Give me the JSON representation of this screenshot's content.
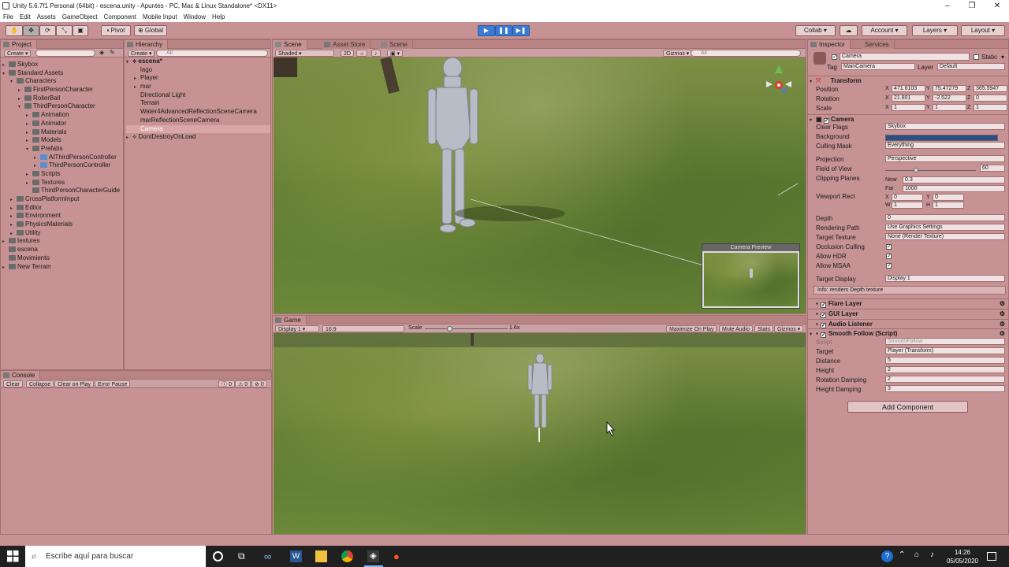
{
  "window": {
    "title": "Unity 5.6.7f1 Personal (64bit) - escena.unity - Apuntes - PC, Mac & Linux Standalone* <DX11>"
  },
  "menu": [
    "File",
    "Edit",
    "Assets",
    "GameObject",
    "Component",
    "Mobile Input",
    "Window",
    "Help"
  ],
  "toolbar": {
    "pivot": "Pivot",
    "global": "Global",
    "collab": "Collab ▾",
    "account": "Account",
    "layers": "Layers",
    "layout": "Layout"
  },
  "project": {
    "tab": "Project",
    "create": "Create",
    "tree": [
      {
        "label": "Skybox",
        "depth": 0,
        "arrow": "▸"
      },
      {
        "label": "Standard Assets",
        "depth": 0,
        "arrow": "▾"
      },
      {
        "label": "Characters",
        "depth": 1,
        "arrow": "▾"
      },
      {
        "label": "FirstPersonCharacter",
        "depth": 2,
        "arrow": "▸"
      },
      {
        "label": "RollerBall",
        "depth": 2,
        "arrow": "▸"
      },
      {
        "label": "ThirdPersonCharacter",
        "depth": 2,
        "arrow": "▾"
      },
      {
        "label": "Animation",
        "depth": 3,
        "arrow": "▸"
      },
      {
        "label": "Animator",
        "depth": 3,
        "arrow": "▸"
      },
      {
        "label": "Materials",
        "depth": 3,
        "arrow": "▸"
      },
      {
        "label": "Models",
        "depth": 3,
        "arrow": "▸"
      },
      {
        "label": "Prefabs",
        "depth": 3,
        "arrow": "▾"
      },
      {
        "label": "AIThirdPersonController",
        "depth": 4,
        "arrow": "▸"
      },
      {
        "label": "ThirdPersonController",
        "depth": 4,
        "arrow": "▸"
      },
      {
        "label": "Scripts",
        "depth": 3,
        "arrow": "▸"
      },
      {
        "label": "Textures",
        "depth": 3,
        "arrow": "▸"
      },
      {
        "label": "ThirdPersonCharacterGuide",
        "depth": 3,
        "arrow": ""
      },
      {
        "label": "CrossPlatformInput",
        "depth": 1,
        "arrow": "▸"
      },
      {
        "label": "Editor",
        "depth": 1,
        "arrow": "▸"
      },
      {
        "label": "Environment",
        "depth": 1,
        "arrow": "▸"
      },
      {
        "label": "PhysicsMaterials",
        "depth": 1,
        "arrow": "▸"
      },
      {
        "label": "Utility",
        "depth": 1,
        "arrow": "▸"
      },
      {
        "label": "textures",
        "depth": 0,
        "arrow": "▸"
      },
      {
        "label": "escena",
        "depth": 0,
        "arrow": ""
      },
      {
        "label": "Movimiento",
        "depth": 0,
        "arrow": ""
      },
      {
        "label": "New Terrain",
        "depth": 0,
        "arrow": "▸"
      }
    ]
  },
  "hierarchy": {
    "tab": "Hierarchy",
    "create": "Create",
    "search": "All",
    "scene": "escena*",
    "items": [
      "lago",
      "Player",
      "mar",
      "Directional Light",
      "Terrain",
      "Water4AdvancedReflectionSceneCamera",
      "marReflectionSceneCamera",
      "Camera"
    ],
    "dont_destroy": "DontDestroyOnLoad"
  },
  "console": {
    "tab": "Console",
    "clear": "Clear",
    "collapse": "Collapse",
    "clear_on_play": "Clear on Play",
    "error_pause": "Error Pause",
    "c1": "0",
    "c2": "0",
    "c3": "0"
  },
  "scene": {
    "tabs": [
      "Scene",
      "Asset Store",
      "Scene"
    ],
    "shaded": "Shaded",
    "mode2d": "2D",
    "gizmos": "Gizmos",
    "search": "All",
    "preview": "Camera Preview"
  },
  "game": {
    "tab": "Game",
    "display": "Display 1",
    "aspect": "16:9",
    "scale_label": "Scale",
    "scale_value": "1.6x",
    "maximize": "Maximize On Play",
    "mute": "Mute Audio",
    "stats": "Stats",
    "gizmos": "Gizmos"
  },
  "inspector": {
    "tabs": [
      "Inspector",
      "Services"
    ],
    "name": "Camera",
    "static": "Static",
    "tag_label": "Tag",
    "tag": "MainCamera",
    "layer_label": "Layer",
    "layer": "Default",
    "transform": {
      "title": "Transform",
      "position": "Position",
      "rotation": "Rotation",
      "scale": "Scale",
      "px": "471.6103",
      "py": "75.47279",
      "pz": "365.5947",
      "rx": "21.801",
      "ry": "-2.522",
      "rz": "0",
      "sx": "1",
      "sy": "1",
      "sz": "1"
    },
    "camera": {
      "title": "Camera",
      "rows": [
        {
          "label": "Clear Flags",
          "value": "Skybox"
        },
        {
          "label": "Background",
          "value": ""
        },
        {
          "label": "Culling Mask",
          "value": "Everything"
        },
        {
          "label": "Projection",
          "value": "Perspective"
        },
        {
          "label": "Field of View",
          "value": "60"
        },
        {
          "label": "Clipping Planes",
          "value": ""
        },
        {
          "label": "Viewport Rect",
          "value": ""
        },
        {
          "label": "Depth",
          "value": "0"
        },
        {
          "label": "Rendering Path",
          "value": "Use Graphics Settings"
        },
        {
          "label": "Target Texture",
          "value": "None (Render Texture)"
        },
        {
          "label": "Occlusion Culling",
          "value": "✓"
        },
        {
          "label": "Allow HDR",
          "value": "✓"
        },
        {
          "label": "Allow MSAA",
          "value": "✓"
        },
        {
          "label": "Target Display",
          "value": "Display 1"
        }
      ],
      "near_label": "Near",
      "near": "0.3",
      "far_label": "Far",
      "far": "1000",
      "vx": "0",
      "vy": "0",
      "vw": "1",
      "vh": "1",
      "info": "Info: renders Depth texture"
    },
    "components": [
      "Flare Layer",
      "GUI Layer",
      "Audio Listener",
      "Smooth Follow (Script)"
    ],
    "smooth": {
      "rows": [
        {
          "label": "Script",
          "value": "SmoothFollow"
        },
        {
          "label": "Target",
          "value": "Player (Transform)"
        },
        {
          "label": "Distance",
          "value": "5"
        },
        {
          "label": "Height",
          "value": "2"
        },
        {
          "label": "Rotation Damping",
          "value": "2"
        },
        {
          "label": "Height Damping",
          "value": "3"
        }
      ]
    },
    "add_component": "Add Component"
  },
  "taskbar": {
    "search": "Escribe aquí para buscar",
    "time": "14:26",
    "date": "05/05/2020"
  },
  "colors": {
    "panel": "#c69293",
    "accent": "#3a7bd5",
    "background_swatch": "#2d4e83"
  }
}
